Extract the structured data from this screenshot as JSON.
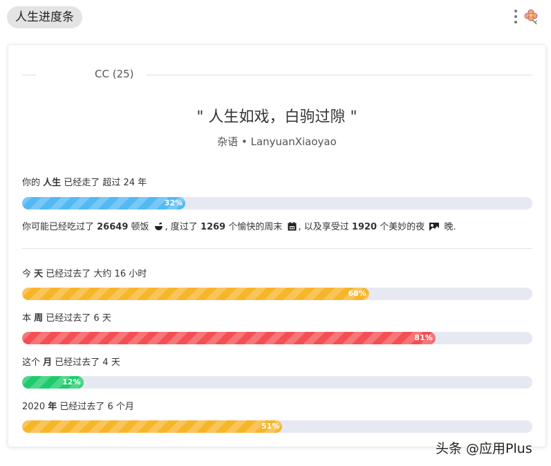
{
  "header": {
    "title": "人生进度条"
  },
  "card": {
    "user": "CC (25)",
    "quote": "\" 人生如戏，白驹过隙 \"",
    "quote_source": "杂语 • LanyuanXiaoyao",
    "life": {
      "pre": "你的 ",
      "bold": "人生",
      "post": " 已经走了 超过 24 年",
      "percent": 32,
      "percent_label": "32%",
      "color": "#52b9f5"
    },
    "stats": {
      "s1": "你可能已经吃过了 ",
      "meals": "26649",
      "s2": " 顿饭 ",
      "s3": ", 度过了 ",
      "weekends": "1269",
      "s4": " 个愉快的周末 ",
      "s5": ", 以及享受过 ",
      "nights": "1920",
      "s6": " 个美妙的夜 ",
      "s7": " 晚.",
      "icons": [
        "bowl-icon",
        "calendar-icon",
        "night-icon"
      ]
    },
    "day": {
      "pre": "今 ",
      "bold": "天",
      "post": " 已经过去了 大约 16 小时",
      "percent": 68,
      "percent_label": "68%",
      "color": "#f7b52a"
    },
    "week": {
      "pre": "本 ",
      "bold": "周",
      "post": " 已经过去了 6 天",
      "percent": 81,
      "percent_label": "81%",
      "color": "#f44f54"
    },
    "month": {
      "pre": "这个 ",
      "bold": "月",
      "post": " 已经过去了 4 天",
      "percent": 12,
      "percent_label": "12%",
      "color": "#1dcb6b"
    },
    "year": {
      "pre": "2020 ",
      "bold": "年",
      "post": " 已经过去了 6 个月",
      "percent": 51,
      "percent_label": "51%",
      "color": "#f7b52a"
    }
  },
  "watermark": "头条 @应用Plus"
}
